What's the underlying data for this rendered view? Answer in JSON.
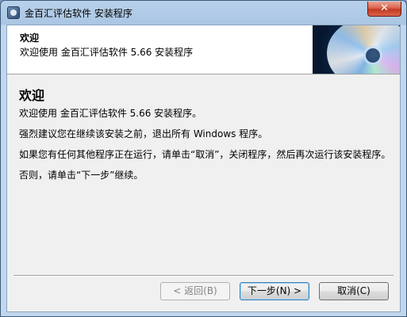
{
  "window": {
    "title": "金百汇评估软件 安装程序",
    "close_label": "✕"
  },
  "header": {
    "title": "欢迎",
    "subtitle": "欢迎使用 金百汇评估软件 5.66 安装程序"
  },
  "body": {
    "title": "欢迎",
    "paragraphs": [
      "欢迎使用 金百汇评估软件 5.66 安装程序。",
      "强烈建议您在继续该安装之前，退出所有 Windows 程序。",
      "如果您有任何其他程序正在运行，请单击“取消”，关闭程序，然后再次运行该安装程序。",
      "否则，请单击“下一步”继续。"
    ]
  },
  "buttons": {
    "back": "< 返回(B)",
    "next": "下一步(N) >",
    "cancel": "取消(C)"
  }
}
